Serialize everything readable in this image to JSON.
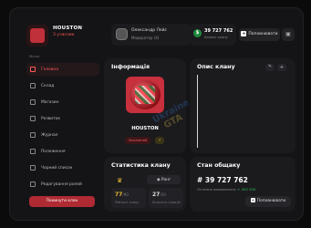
{
  "header": {
    "clan_name": "HOUSTON",
    "clan_members": "3 учасник",
    "user_name": "Олександр Лейс",
    "user_role": "Модератор (4)",
    "balance": "39 727 762",
    "balance_label": "Баланс клану",
    "topup_label": "Поповнювати"
  },
  "sidebar": {
    "menu_label": "Меню",
    "items": [
      {
        "label": "Головна"
      },
      {
        "label": "Склад"
      },
      {
        "label": "Магазин"
      },
      {
        "label": "Розвиток"
      },
      {
        "label": "Журнал"
      },
      {
        "label": "Положення"
      },
      {
        "label": "Чорний список"
      },
      {
        "label": "Редагування ролей"
      }
    ],
    "leave_label": "Покинути клан"
  },
  "info": {
    "title": "Інформація",
    "name": "HOUSTON",
    "badge": "Зачинений",
    "badge_small": "⚡"
  },
  "description": {
    "title": "Опис клану",
    "edit_icon": "✎",
    "plus_icon": "+"
  },
  "stats": {
    "title": "Статистика клану",
    "rank_button": "Ранг",
    "rating_value": "77",
    "rating_max": "/90",
    "rating_label": "Рейтинг клану",
    "members_value": "27",
    "members_max": "/50",
    "members_label": "Кількість гравців"
  },
  "bank": {
    "title": "Стан общаку",
    "amount": "# 39 727 762",
    "last_label": "Останнє поповнення",
    "last_value": "+ 452 550",
    "button_label": "Поповнювати"
  },
  "watermark": {
    "line1": "Ukraine",
    "line2": "GTA"
  },
  "colors": {
    "accent": "#ff5a5a",
    "danger": "#b02a33",
    "success": "#2fc45d",
    "gold": "#e8b930"
  }
}
